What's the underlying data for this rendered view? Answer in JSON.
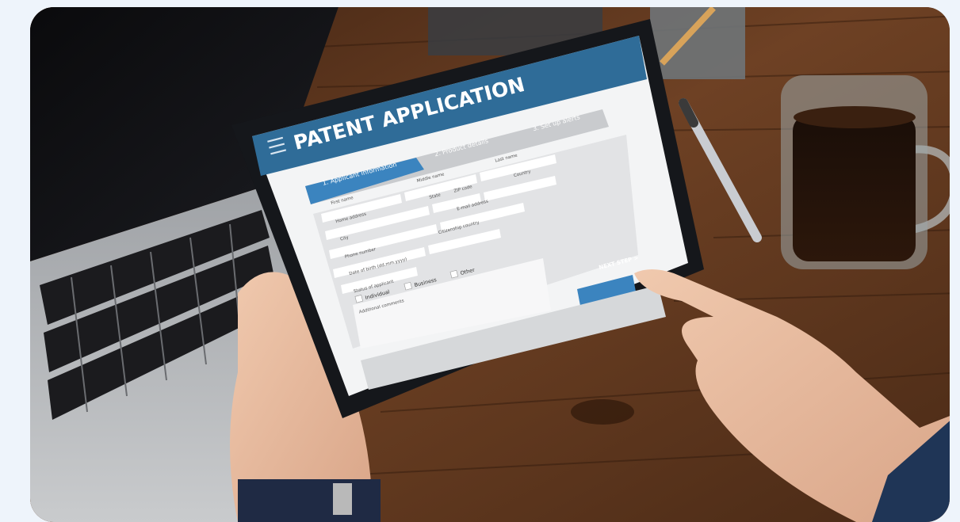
{
  "title": "PATENT APPLICATION",
  "steps": [
    {
      "label": "1. Applicant information"
    },
    {
      "label": "2. Product details"
    },
    {
      "label": "3. Set up alerts"
    }
  ],
  "fields": {
    "first_name": "First name",
    "middle_name": "Middle name",
    "last_name": "Last name",
    "home_address": "Home address",
    "state": "State",
    "zip_code": "ZIP code",
    "country": "Country",
    "city": "City",
    "email": "E-mail address",
    "phone": "Phone number",
    "citizenship": "Citizenship country",
    "dob": "Date of birth (dd.mm.yyyy)",
    "status": "Status of applicant",
    "comments": "Additional comments"
  },
  "status_options": [
    "Individual",
    "Business",
    "Other"
  ],
  "next_button": "NEXT STEP >",
  "colors": {
    "header": "#2f6c98",
    "accent": "#3b84bf",
    "wood": "#6a3f22"
  }
}
